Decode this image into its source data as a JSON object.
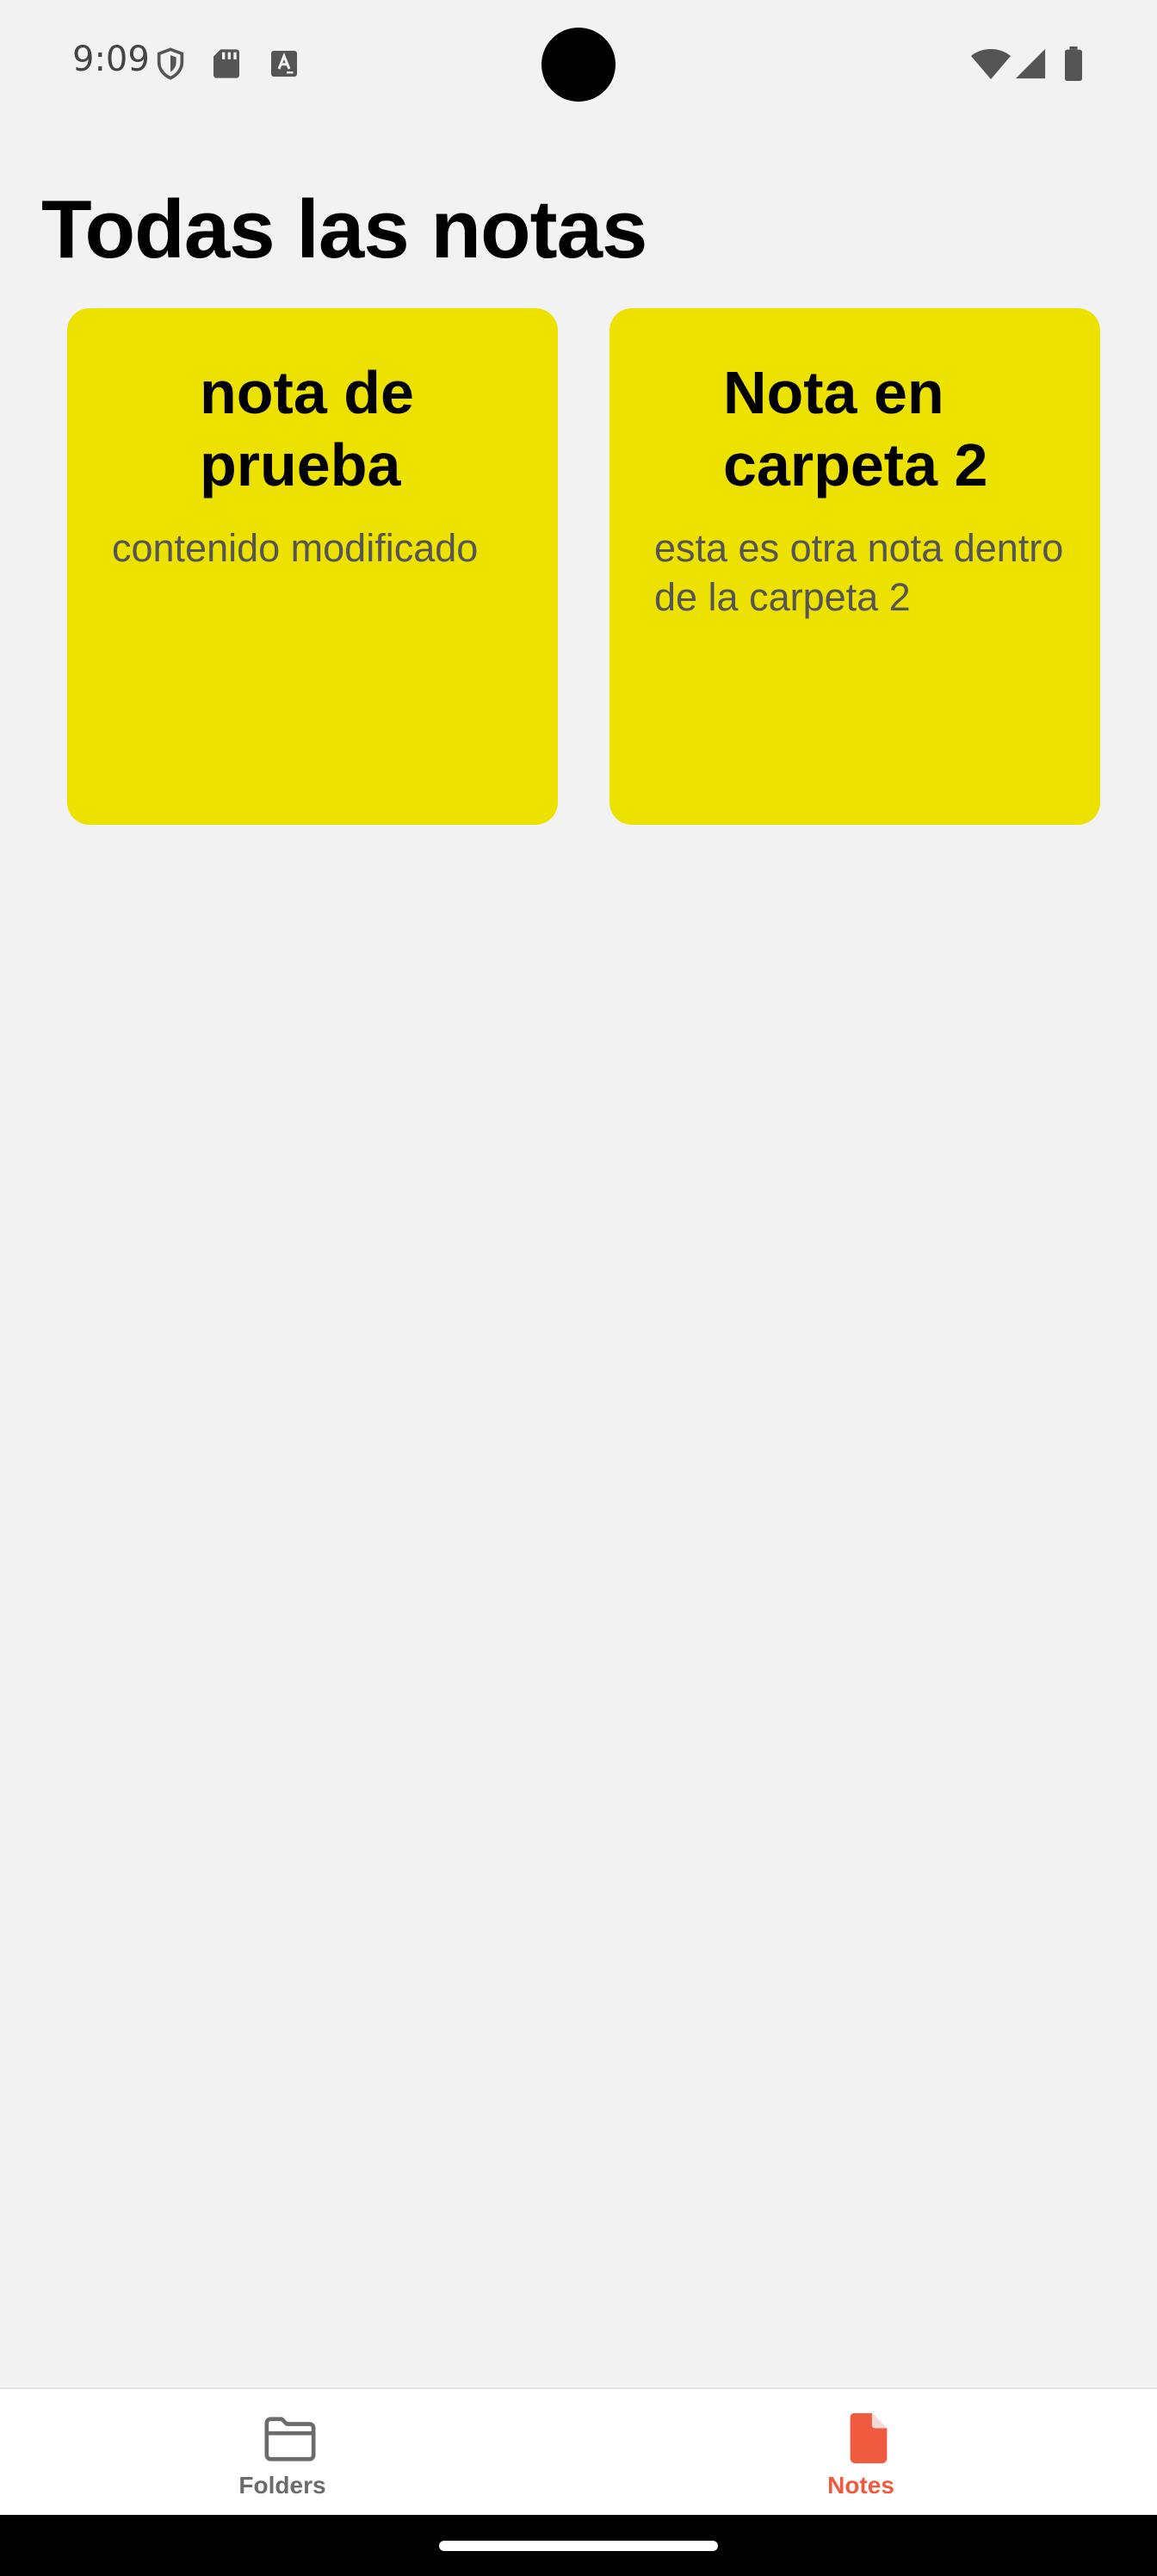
{
  "status_bar": {
    "time": "9:09",
    "icons": [
      "shield-icon",
      "sd-card-icon",
      "keyboard-a-icon",
      "wifi-icon",
      "signal-icon",
      "battery-icon"
    ]
  },
  "page": {
    "title": "Todas las notas"
  },
  "notes": [
    {
      "title": "nota de prueba",
      "content": "contenido modificado",
      "color": "#ede100"
    },
    {
      "title": "Nota en carpeta 2",
      "content": "esta es otra nota dentro de la carpeta 2",
      "color": "#ede100"
    }
  ],
  "bottom_nav": {
    "items": [
      {
        "label": "Folders",
        "icon": "folder-icon",
        "active": false
      },
      {
        "label": "Notes",
        "icon": "note-icon",
        "active": true
      }
    ],
    "active_color": "#f05a3f",
    "inactive_color": "#6b6b6b"
  }
}
